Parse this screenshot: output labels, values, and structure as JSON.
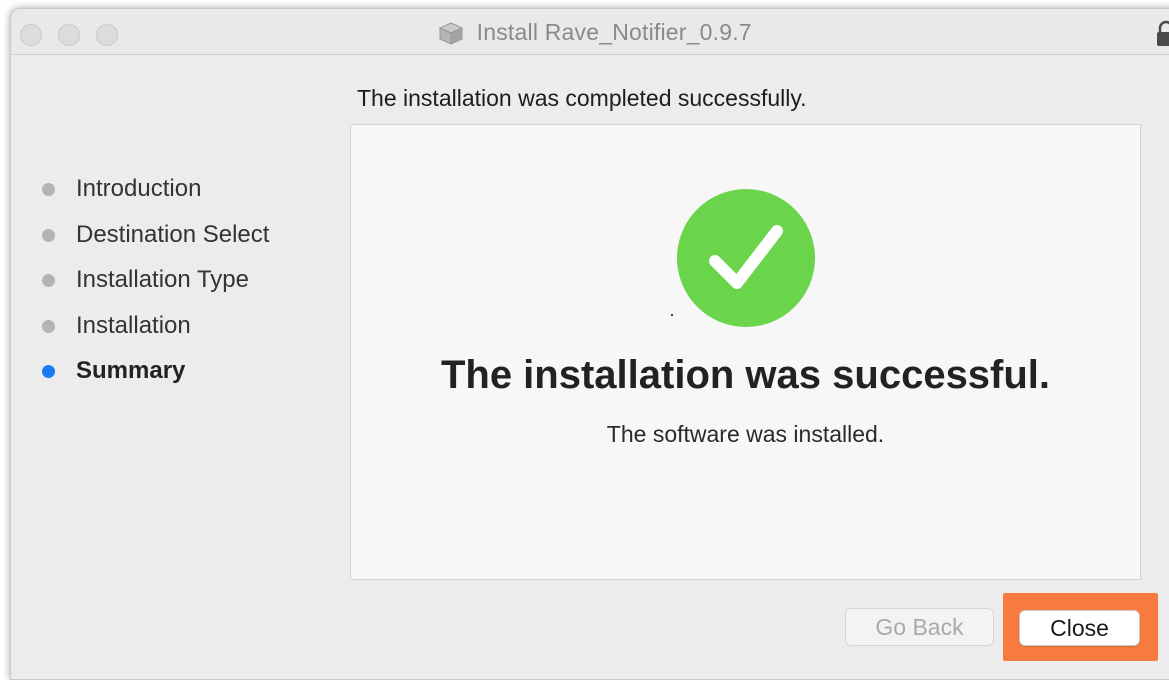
{
  "window": {
    "title": "Install Rave_Notifier_0.9.7",
    "package_icon": "package-box-icon",
    "lock_icon": "lock-icon"
  },
  "header": {
    "message": "The installation was completed successfully."
  },
  "sidebar": {
    "items": [
      {
        "label": "Introduction",
        "active": false
      },
      {
        "label": "Destination Select",
        "active": false
      },
      {
        "label": "Installation Type",
        "active": false
      },
      {
        "label": "Installation",
        "active": false
      },
      {
        "label": "Summary",
        "active": true
      }
    ]
  },
  "main": {
    "status_icon": "checkmark-circle-icon",
    "title": "The installation was successful.",
    "subtitle": "The software was installed."
  },
  "buttons": {
    "back_label": "Go Back",
    "close_label": "Close"
  },
  "colors": {
    "success_green": "#6ad44b",
    "active_step": "#1a7cf4",
    "highlight": "#f97a3e"
  }
}
